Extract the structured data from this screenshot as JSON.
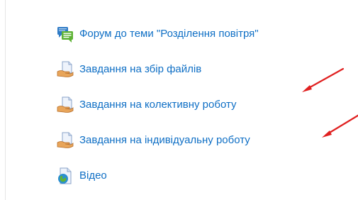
{
  "activities": [
    {
      "label": "Форум до теми \"Розділення повітря\"",
      "icon": "forum-icon"
    },
    {
      "label": "Завдання на збір файлів",
      "icon": "assignment-icon"
    },
    {
      "label": "Завдання на колективну роботу",
      "icon": "assignment-icon"
    },
    {
      "label": "Завдання на індивідуальну роботу",
      "icon": "assignment-icon"
    },
    {
      "label": "Відео",
      "icon": "video-file-icon"
    }
  ],
  "colors": {
    "link": "#0f6fc5",
    "arrow": "#e02020",
    "forum_back_bubble": "#2f7bc6",
    "forum_front_bubble": "#5fb336"
  },
  "annotation_arrows": [
    "pointing-to-item-3",
    "pointing-to-item-4"
  ]
}
